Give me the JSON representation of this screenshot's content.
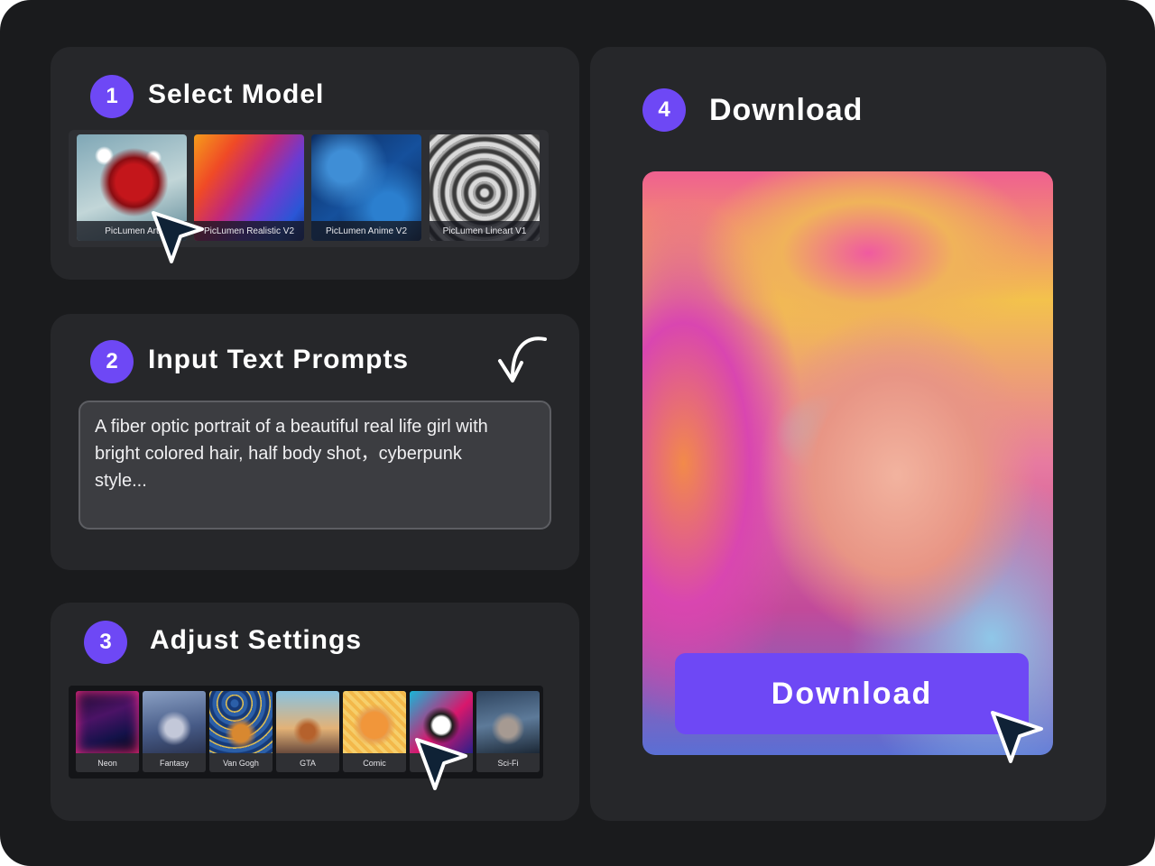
{
  "steps": [
    {
      "number": "1",
      "title": "Select Model"
    },
    {
      "number": "2",
      "title": "Input Text Prompts"
    },
    {
      "number": "3",
      "title": "Adjust Settings"
    },
    {
      "number": "4",
      "title": "Download"
    }
  ],
  "models": [
    {
      "label": "PicLumen Art",
      "icon": "rose-thumbnail"
    },
    {
      "label": "PicLumen Realistic V2",
      "icon": "wave-thumbnail"
    },
    {
      "label": "PicLumen Anime V2",
      "icon": "blue-swirl-thumbnail"
    },
    {
      "label": "PicLumen Lineart V1",
      "icon": "gray-lines-thumbnail"
    }
  ],
  "prompt": {
    "text": "A fiber optic portrait of a beautiful real life girl with bright colored hair, half body shot，cyberpunk style..."
  },
  "styles": [
    {
      "label": "Neon"
    },
    {
      "label": "Fantasy"
    },
    {
      "label": "Van Gogh"
    },
    {
      "label": "GTA"
    },
    {
      "label": "Comic"
    },
    {
      "label": ""
    },
    {
      "label": "Sci-Fi"
    }
  ],
  "download": {
    "button_label": "Download"
  },
  "colors": {
    "background": "#1a1b1d",
    "card": "#26272a",
    "accent": "#6e48f5"
  }
}
